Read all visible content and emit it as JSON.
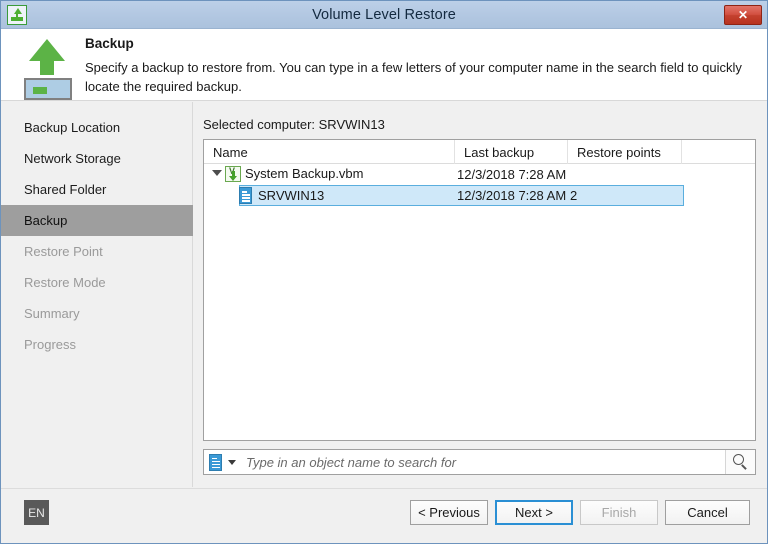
{
  "window": {
    "title": "Volume Level Restore",
    "title_icon": "restore-up-arrow-icon",
    "close_label": "✕"
  },
  "banner": {
    "icon": "volume-restore-arrow-icon",
    "title": "Backup",
    "description": "Specify a backup to restore from. You can type in a few letters of your computer name in the search field to quickly locate the required backup."
  },
  "sidebar": {
    "items": [
      {
        "label": "Backup Location",
        "state": "done"
      },
      {
        "label": "Network Storage",
        "state": "done"
      },
      {
        "label": "Shared Folder",
        "state": "done"
      },
      {
        "label": "Backup",
        "state": "active"
      },
      {
        "label": "Restore Point",
        "state": "disabled"
      },
      {
        "label": "Restore Mode",
        "state": "disabled"
      },
      {
        "label": "Summary",
        "state": "disabled"
      },
      {
        "label": "Progress",
        "state": "disabled"
      }
    ]
  },
  "main": {
    "selected_computer_label": "Selected computer: SRVWIN13",
    "columns": [
      "Name",
      "Last backup",
      "Restore points",
      ""
    ],
    "rows": [
      {
        "name": "System Backup.vbm",
        "last_backup": "12/3/2018 7:28 AM",
        "restore_points": "",
        "icon": "vbm-file-icon",
        "level": 0,
        "expanded": true,
        "selected": false
      },
      {
        "name": "SRVWIN13",
        "last_backup": "12/3/2018 7:28 AM",
        "restore_points": "2",
        "icon": "server-icon",
        "level": 1,
        "expanded": false,
        "selected": true
      }
    ],
    "search": {
      "icon": "server-icon",
      "dropdown_icon": "chevron-down-icon",
      "placeholder": "Type in an object name to search for",
      "value": "",
      "go_icon": "search-icon"
    }
  },
  "footer": {
    "language": "EN",
    "buttons": {
      "previous": "< Previous",
      "next": "Next >",
      "finish": "Finish",
      "cancel": "Cancel"
    }
  },
  "colors": {
    "titlebar": "#b3c8e2",
    "accent_green": "#5cb346",
    "selection_blue": "#cfe8f9",
    "selection_border": "#5aaede",
    "focus_blue": "#2a8fd4",
    "nav_active": "#9e9e9e",
    "close_red": "#c4412f"
  }
}
